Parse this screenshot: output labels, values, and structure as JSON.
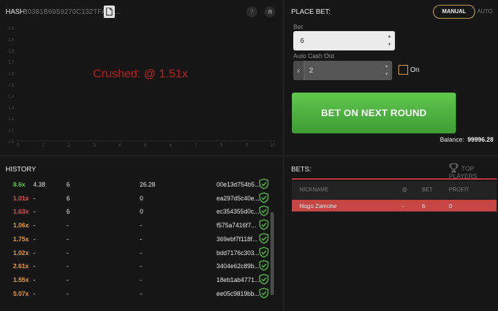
{
  "hash": {
    "label": "HASH:",
    "value": "B0381B6959270C132TFA04..."
  },
  "icons": {
    "copy": "copy-icon",
    "help": "question-icon",
    "home": "home-icon",
    "check": "shield-check-icon",
    "trophy": "trophy-icon"
  },
  "graph": {
    "message": "Crushed: @ 1.51x",
    "message_color": "#b81f1f",
    "y_ticks": [
      "2.0",
      "1.9",
      "1.8",
      "1.7",
      "1.6",
      "1.5",
      "1.4",
      "1.3",
      "1.2",
      "1.1",
      "1.0"
    ],
    "x_ticks": [
      "0",
      "1",
      "2",
      "3",
      "4",
      "5",
      "6",
      "7",
      "8",
      "9",
      "10"
    ]
  },
  "place_bet": {
    "title": "PLACE BET:",
    "tab_manual": "MANUAL",
    "tab_auto": "AUTO",
    "bet_label": "Bet",
    "bet_value": "6",
    "auto_cashout_label": "Auto Cash Out",
    "cashout_prefix": "x",
    "cashout_value": "2",
    "on_label": "On",
    "button_label": "BET ON NEXT ROUND",
    "balance_label": "Balance:",
    "balance_value": "99996.28"
  },
  "history": {
    "title": "HISTORY",
    "rows": [
      {
        "mult": "8.6x",
        "color": "#59c23f",
        "at": "4.38",
        "bet": "6",
        "profit": "26.28",
        "hash": "00e13d754b5..."
      },
      {
        "mult": "1.01x",
        "color": "#e04a4a",
        "at": "-",
        "bet": "6",
        "profit": "0",
        "hash": "ea297d5c40e..."
      },
      {
        "mult": "1.63x",
        "color": "#e04a4a",
        "at": "-",
        "bet": "6",
        "profit": "0",
        "hash": "ec354355d0c..."
      },
      {
        "mult": "1.06x",
        "color": "#e59a2a",
        "at": "-",
        "bet": "-",
        "profit": "-",
        "hash": "f575a7416f7..."
      },
      {
        "mult": "1.75x",
        "color": "#e59a2a",
        "at": "-",
        "bet": "-",
        "profit": "-",
        "hash": "369ebf7f118f..."
      },
      {
        "mult": "1.02x",
        "color": "#e59a2a",
        "at": "-",
        "bet": "-",
        "profit": "-",
        "hash": "bdd7176c303..."
      },
      {
        "mult": "2.61x",
        "color": "#e59a2a",
        "at": "-",
        "bet": "-",
        "profit": "-",
        "hash": "3404e62c89b..."
      },
      {
        "mult": "1.55x",
        "color": "#e59a2a",
        "at": "-",
        "bet": "-",
        "profit": "-",
        "hash": "18eb1ab4771..."
      },
      {
        "mult": "5.07x",
        "color": "#e59a2a",
        "at": "-",
        "bet": "-",
        "profit": "-",
        "hash": "ee05c9819bb..."
      }
    ]
  },
  "bets": {
    "title": "BETS:",
    "top_players": "TOP PLAYERS",
    "columns": {
      "nickname": "NICKNAME",
      "at": "@",
      "bet": "BET",
      "profit": "PROFIT"
    },
    "rows": [
      {
        "nickname": "Nogo Zamohe",
        "at": "-",
        "bet": "6",
        "profit": "0"
      }
    ]
  },
  "colors": {
    "background": "#161616",
    "accent_green": "#4caf3e",
    "accent_red": "#c64545",
    "accent_gold": "#c9a34a"
  }
}
